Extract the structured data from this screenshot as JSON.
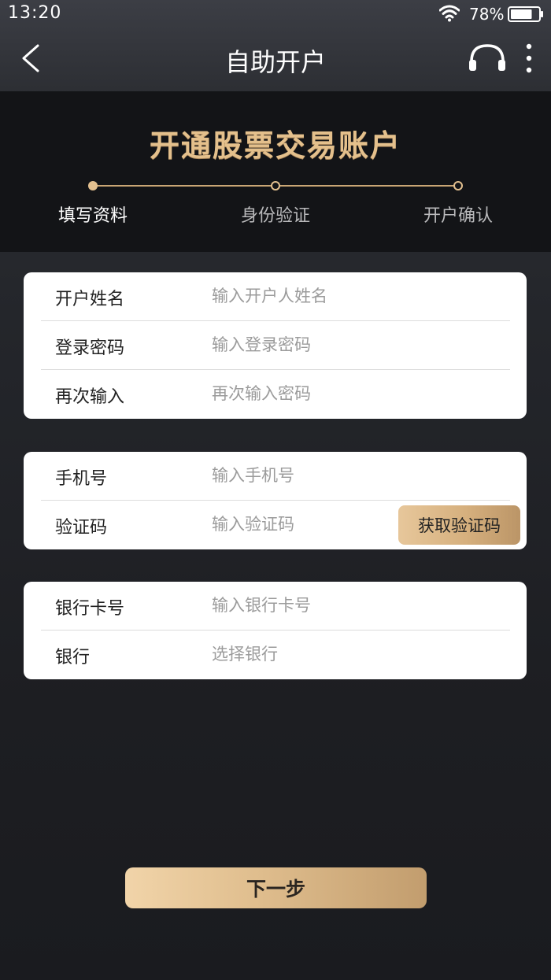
{
  "status_bar": {
    "time": "13:20",
    "battery_percent": "78%",
    "battery_level": 0.78,
    "icons": [
      "wifi-icon",
      "battery-icon"
    ]
  },
  "nav": {
    "title": "自助开户",
    "icons": [
      "back-arrow-icon",
      "headset-icon",
      "more-vertical-icon"
    ]
  },
  "header": {
    "title": "开通股票交易账户",
    "steps": [
      {
        "label": "填写资料",
        "state": "active"
      },
      {
        "label": "身份验证",
        "state": "pending"
      },
      {
        "label": "开户确认",
        "state": "pending"
      }
    ]
  },
  "form": {
    "account_group": {
      "name": {
        "label": "开户姓名",
        "placeholder": "输入开户人姓名",
        "value": ""
      },
      "password": {
        "label": "登录密码",
        "placeholder": "输入登录密码",
        "value": ""
      },
      "password_confirm": {
        "label": "再次输入",
        "placeholder": "再次输入密码",
        "value": ""
      }
    },
    "phone_group": {
      "phone": {
        "label": "手机号",
        "placeholder": "输入手机号",
        "value": ""
      },
      "code": {
        "label": "验证码",
        "placeholder": "输入验证码",
        "value": ""
      },
      "get_code_label": "获取验证码"
    },
    "bank_group": {
      "card": {
        "label": "银行卡号",
        "placeholder": "输入银行卡号",
        "value": ""
      },
      "bank": {
        "label": "银行",
        "placeholder": "选择银行",
        "value": ""
      }
    }
  },
  "next_button_label": "下一步",
  "colors": {
    "accent_gold": "#e3c08f",
    "banner_bg": "#131417",
    "page_bg": "#24262b",
    "card_bg": "#ffffff",
    "placeholder": "#9b9b9b"
  }
}
